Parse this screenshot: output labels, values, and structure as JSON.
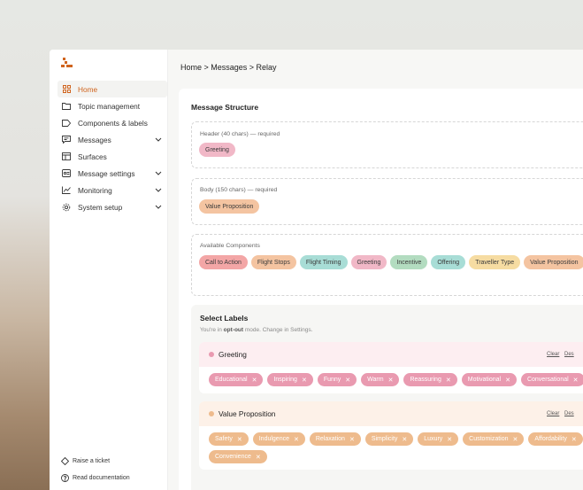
{
  "colors": {
    "accent": "#d0641e",
    "chip_pink": "#f1b8c7",
    "chip_orange": "#f4c4a1",
    "chip_red": "#f3a6a6",
    "chip_teal": "#a8ddd6",
    "chip_green": "#b3dcc0",
    "chip_yellow": "#f6dca2",
    "label_pink": "#e99ab0",
    "label_orange": "#eebb8d"
  },
  "sidebar": {
    "logo_icon": "brand-logo-icon",
    "items": [
      {
        "label": "Home",
        "icon": "grid-icon",
        "active": true
      },
      {
        "label": "Topic management",
        "icon": "folder-icon"
      },
      {
        "label": "Components & labels",
        "icon": "tag-icon"
      },
      {
        "label": "Messages",
        "icon": "message-icon",
        "expandable": true
      },
      {
        "label": "Surfaces",
        "icon": "layout-icon"
      },
      {
        "label": "Message settings",
        "icon": "settings-message-icon",
        "expandable": true
      },
      {
        "label": "Monitoring",
        "icon": "chart-icon",
        "expandable": true
      },
      {
        "label": "System setup",
        "icon": "gear-icon",
        "expandable": true
      }
    ],
    "footer": {
      "ticket": "Raise a ticket",
      "docs": "Read documentation"
    }
  },
  "breadcrumb": "Home > Messages > Relay",
  "structure": {
    "title": "Message Structure",
    "header": {
      "label": "Header (40 chars) — required",
      "chips": [
        "Greeting"
      ]
    },
    "body": {
      "label": "Body (150 chars) — required",
      "chips": [
        "Value Proposition"
      ]
    },
    "available": {
      "label": "Available Components",
      "chips": [
        "Call to Action",
        "Flight Stops",
        "Flight Timing",
        "Greeting",
        "Incentive",
        "Offering",
        "Traveller Type",
        "Value Proposition"
      ]
    }
  },
  "labels": {
    "title": "Select Labels",
    "sub_prefix": "You're in ",
    "sub_mode": "opt-out",
    "sub_suffix": " mode. Change in Settings.",
    "clear": "Clear",
    "deselect": "Des",
    "groups": [
      {
        "title": "Greeting",
        "items": [
          "Educational",
          "Inspiring",
          "Funny",
          "Warm",
          "Reassuring",
          "Motivational",
          "Conversational"
        ]
      },
      {
        "title": "Value Proposition",
        "items": [
          "Safety",
          "Indulgence",
          "Relaxation",
          "Simplicity",
          "Luxury",
          "Customization",
          "Affordability",
          "Convenience"
        ]
      }
    ]
  }
}
